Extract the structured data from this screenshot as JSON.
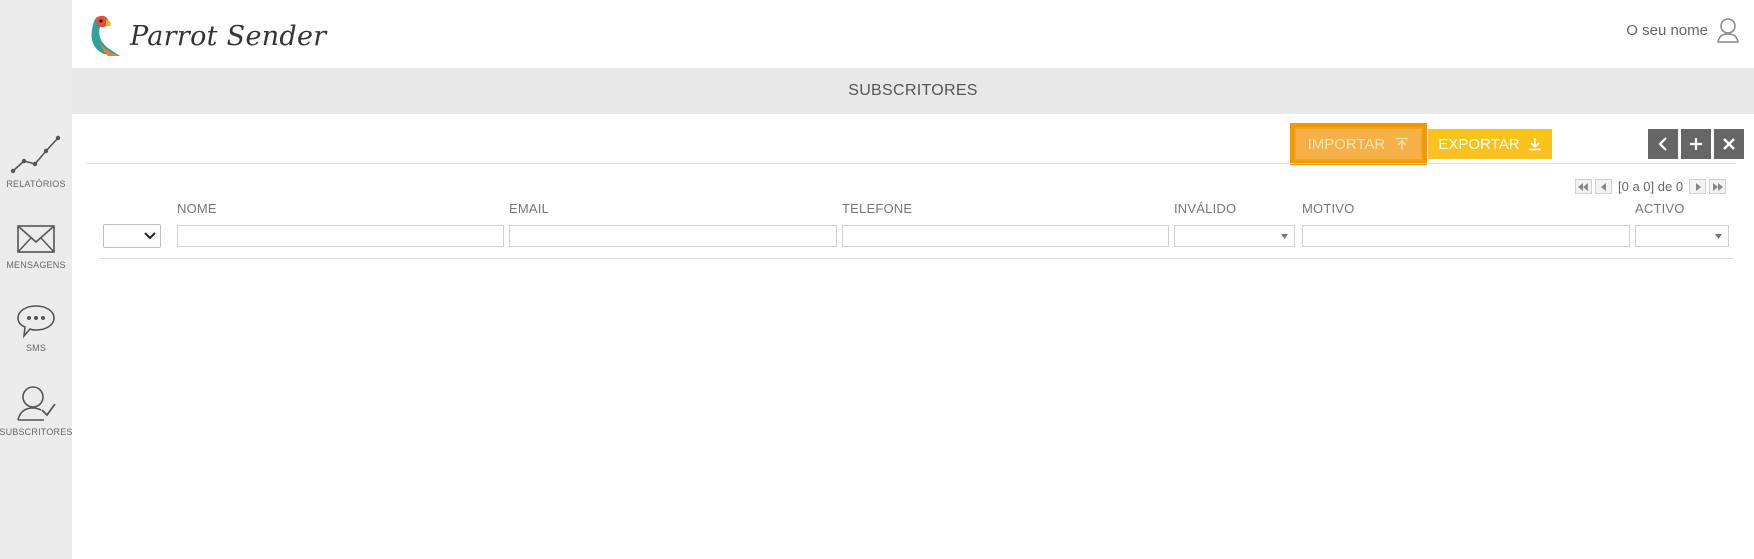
{
  "app": {
    "brand_name": "Parrot Sender",
    "user_name": "O seu nome"
  },
  "sidebar": {
    "items": [
      {
        "id": "relatorios",
        "label": "RELATÓRIOS",
        "icon": "line-chart-icon"
      },
      {
        "id": "mensagens",
        "label": "MENSAGENS",
        "icon": "envelope-icon"
      },
      {
        "id": "sms",
        "label": "SMS",
        "icon": "chat-bubble-icon"
      },
      {
        "id": "subscritores",
        "label": "SUBSCRITORES",
        "icon": "user-check-icon"
      }
    ]
  },
  "page": {
    "title": "SUBSCRITORES"
  },
  "toolbar": {
    "import_label": "IMPORTAR",
    "export_label": "EXPORTAR",
    "back_icon": "chevron-left-icon",
    "add_icon": "plus-icon",
    "close_icon": "close-icon"
  },
  "pager": {
    "text": "[0 a 0] de 0"
  },
  "table": {
    "columns": [
      "NOME",
      "EMAIL",
      "TELEFONE",
      "INVÁLIDO",
      "MOTIVO",
      "ACTIVO"
    ]
  },
  "colors": {
    "import_highlight": "#f59700",
    "import_button": "#f6b048",
    "export_button": "#f9c21e",
    "icon_button": "#666666",
    "sidebar_bg": "#ececec",
    "band_bg": "#e8e8e8"
  }
}
